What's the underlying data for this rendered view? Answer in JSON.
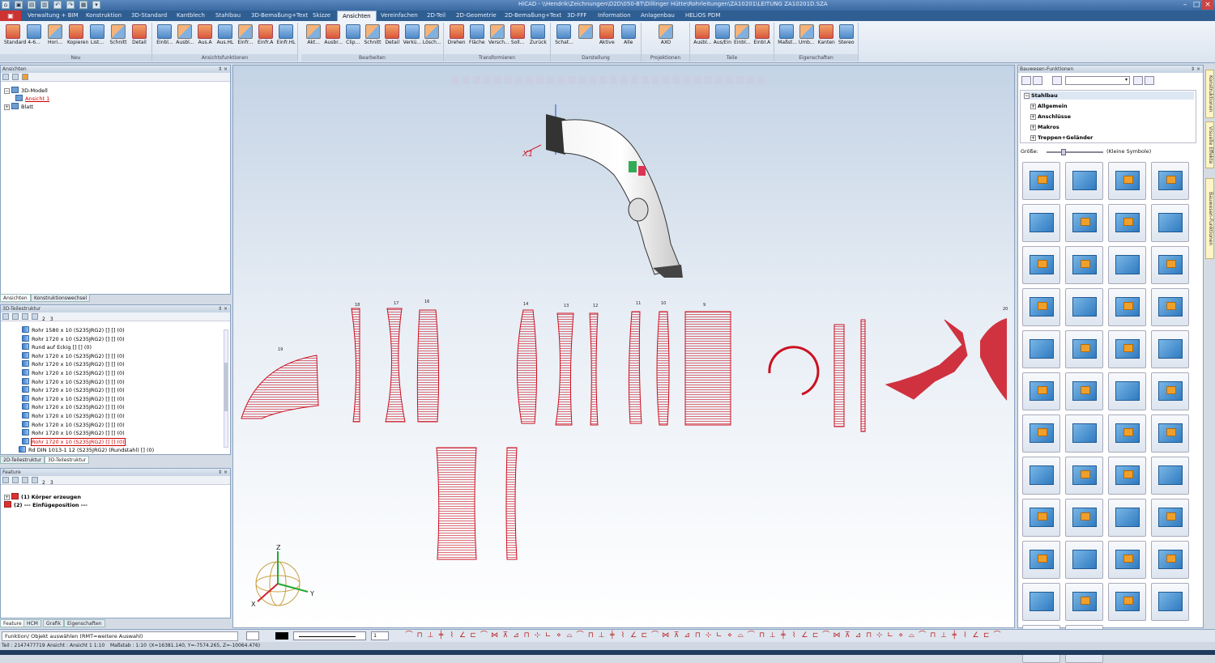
{
  "window": {
    "title": "HiCAD - \\\\Hendrik\\Zeichnungen\\D2D\\050-BT\\Dillinger Hütte\\Rohrleitungen\\ZA10201\\LEITUNG ZA10201D.SZA",
    "quick_access": [
      "⌂",
      "▣",
      "▤",
      "▥",
      "↶",
      "↷",
      "▦",
      "▾"
    ]
  },
  "tabs": [
    "Verwaltung + BIM",
    "Konstruktion",
    "3D-Standard",
    "Kantblech",
    "Stahlbau",
    "3D-Bemaßung+Text",
    "Skizze",
    "Ansichten",
    "Vereinfachen",
    "2D-Teil",
    "2D-Geometrie",
    "2D-Bemaßung+Text",
    "3D-FFF",
    "Information",
    "Anlagenbau",
    "HELiOS PDM"
  ],
  "active_tab": "Ansichten",
  "ribbon": {
    "groups": [
      {
        "name": "Neu",
        "buttons": [
          "Standard",
          "4-6...",
          "Hori...",
          "Kopieren",
          "List...",
          "Schnitt",
          "Detail"
        ]
      },
      {
        "name": "Ansichtsfunktionen",
        "buttons": [
          "Einbl...",
          "Ausbl...",
          "Aus.A",
          "Aus.HL",
          "Einfr...",
          "Einfr.A",
          "Einfr.HL"
        ]
      },
      {
        "name": "Bearbeiten",
        "buttons": [
          "Akt...",
          "Ausbr...",
          "Clip...",
          "Schnitt",
          "Detail",
          "Verkü...",
          "Lösch..."
        ]
      },
      {
        "name": "Transformieren",
        "buttons": [
          "Drehen",
          "Fläche",
          "Versch...",
          "Soll...",
          "Zurück"
        ]
      },
      {
        "name": "Darstellung",
        "buttons": [
          "Schat...",
          "",
          "Aktive",
          "Alle"
        ]
      },
      {
        "name": "Projektionen",
        "buttons": [
          "AXO"
        ]
      },
      {
        "name": "Teile",
        "buttons": [
          "Ausbl...",
          "Aus/Ein",
          "Einbl...",
          "Einbl.A"
        ]
      },
      {
        "name": "Eigenschaften",
        "buttons": [
          "Maßst...",
          "Umb...",
          "Kanten",
          "Stereo"
        ]
      }
    ]
  },
  "views_panel": {
    "title": "Ansichten",
    "tree": [
      {
        "label": "3D-Modell",
        "level": 0,
        "expander": "−"
      },
      {
        "label": "Ansicht 1",
        "level": 1,
        "active": true
      },
      {
        "label": "Blatt",
        "level": 0,
        "expander": "+"
      }
    ],
    "tabs": [
      "Ansichten",
      "Konstruktionswechsel"
    ]
  },
  "structure_panel": {
    "title": "3D-Teilestruktur",
    "toolbar_numbers": [
      "2",
      "3"
    ],
    "rows": [
      "Rohr 1580 x 10 (S235JRG2) [] [] (0)",
      "Rohr 1720 x 10 (S235JRG2) [] [] (0)",
      "Rund auf Eckig [] [] (0)",
      "Rohr 1720 x 10 (S235JRG2) [] [] (0)",
      "Rohr 1720 x 10 (S235JRG2) [] [] (0)",
      "Rohr 1720 x 10 (S235JRG2) [] [] (0)",
      "Rohr 1720 x 10 (S235JRG2) [] [] (0)",
      "Rohr 1720 x 10 (S235JRG2) [] [] (0)",
      "Rohr 1720 x 10 (S235JRG2) [] [] (0)",
      "Rohr 1720 x 10 (S235JRG2) [] [] (0)",
      "Rohr 1720 x 10 (S235JRG2) [] [] (0)",
      "Rohr 1720 x 10 (S235JRG2) [] [] (0)",
      "Rohr 1720 x 10 (S235JRG2) [] [] (0)",
      "Rohr 1720 x 10 (S235JRG2) [] [] (0)",
      "Rd DIN 1013-1 12 (S235JRG2) (Rundstahl) [] (0)"
    ],
    "tabs": [
      "2D-Teilestruktur",
      "3D-Teilestruktur"
    ]
  },
  "feature_panel": {
    "title": "Feature",
    "toolbar_numbers": [
      "2",
      "3"
    ],
    "rows": [
      "(1) Körper erzeugen",
      "(2) --- Einfügeposition ---"
    ],
    "tabs": [
      "Feature",
      "HCM",
      "Grafik",
      "Eigenschaften"
    ]
  },
  "viewport": {
    "axis_label": "X1",
    "part_numbers": [
      "19",
      "18",
      "17",
      "16",
      "14",
      "13",
      "12",
      "11",
      "10",
      "9",
      "20"
    ],
    "triad_labels": [
      "Z",
      "Y",
      "X"
    ]
  },
  "catalog_panel": {
    "title": "Bauwesen-Funktionen",
    "tree": [
      {
        "label": "Stahlbau",
        "level": 0,
        "expander": "−"
      },
      {
        "label": "Allgemein",
        "level": 1,
        "expander": "+"
      },
      {
        "label": "Anschlüsse",
        "level": 1,
        "expander": "+"
      },
      {
        "label": "Makros",
        "level": 1,
        "expander": "+"
      },
      {
        "label": "Treppen+Geländer",
        "level": 1,
        "expander": "+"
      }
    ],
    "size_label": "Größe:",
    "size_note": "(Kleine Symbole)",
    "size_slider_value": 0.3,
    "tile_count": 46
  },
  "side_tabs": [
    "Konstruktionen",
    "Visuelle Effekte",
    "Bauwesen-Funktionen"
  ],
  "command_line": {
    "prompt": "Funktion/ Objekt auswählen (RMT=weitere Auswahl)",
    "line_scale_value": "1"
  },
  "status": {
    "part": "Teil : 2147477719",
    "view": "Ansicht : Ansicht 1 1:10",
    "scale": "Maßstab : 1:10",
    "coords": "(X=16381.140, Y=-7574.265, Z=-10064.476)"
  },
  "colors": {
    "accent": "#2f5e92",
    "part_red": "#cc1020",
    "viewport_top": "#c4d3e5"
  }
}
